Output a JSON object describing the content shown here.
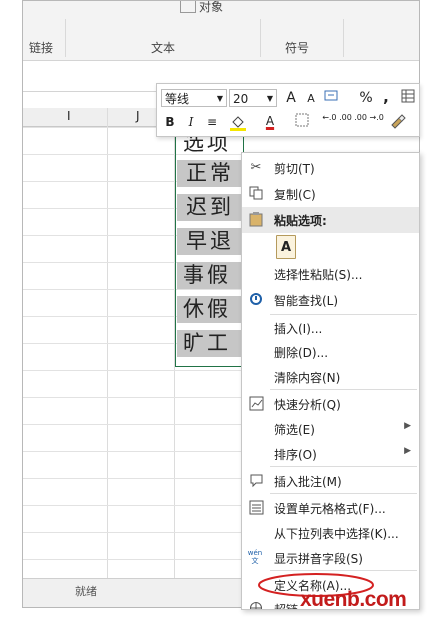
{
  "ribbon": {
    "groups": [
      "链接",
      "文本",
      "符号"
    ],
    "top_label": "对象"
  },
  "columns": {
    "i": "I",
    "j": "J"
  },
  "cells": [
    "选项",
    "正常",
    "迟到",
    "早退",
    "事假",
    "休假",
    "旷工"
  ],
  "mini_toolbar": {
    "font_name": "等线",
    "font_size": "20",
    "grow": "A",
    "shrink": "A",
    "percent": "%",
    "comma": ",",
    "bold": "B",
    "italic": "I",
    "align": "≡",
    "font_color": "A",
    "dec_inc": "←.0 .00",
    "dec_dec": ".00 →.0"
  },
  "context_menu": {
    "items": [
      {
        "label": "剪切(T)",
        "icon": "scissors-icon"
      },
      {
        "label": "复制(C)",
        "icon": "copy-icon"
      },
      {
        "label": "粘贴选项:",
        "icon": "clipboard-icon"
      },
      {
        "label": "选择性粘贴(S)..."
      },
      {
        "label": "智能查找(L)",
        "icon": "smart-lookup-icon"
      },
      {
        "label": "插入(I)..."
      },
      {
        "label": "删除(D)..."
      },
      {
        "label": "清除内容(N)"
      },
      {
        "label": "快速分析(Q)",
        "icon": "quick-analysis-icon"
      },
      {
        "label": "筛选(E)"
      },
      {
        "label": "排序(O)"
      },
      {
        "label": "插入批注(M)",
        "icon": "comment-icon"
      },
      {
        "label": "设置单元格格式(F)...",
        "icon": "format-cells-icon"
      },
      {
        "label": "从下拉列表中选择(K)..."
      },
      {
        "label": "显示拼音字段(S)",
        "icon": "phonetic-icon"
      },
      {
        "label": "定义名称(A)..."
      },
      {
        "label": "超链"
      }
    ],
    "paste_glyph": "A",
    "phonetic_glyph": "wén 文"
  },
  "bottom": {
    "sheet_label": "就绪"
  },
  "watermark": "xuenb.com",
  "colors": {
    "accent": "#217346",
    "selection": "#c6c6c6",
    "watermark": "#c21b1b"
  }
}
